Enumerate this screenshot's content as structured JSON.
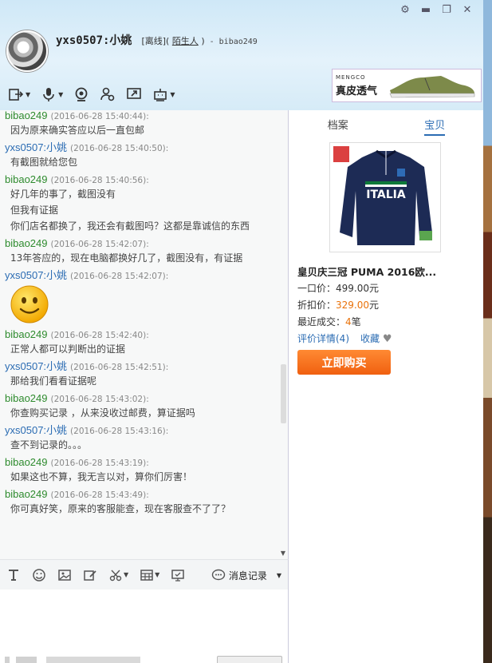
{
  "header": {
    "user_name": "yxs0507:小姚",
    "status_prefix": "[离线](",
    "stranger_label": "陌生人",
    "status_suffix": ")",
    "peer_label": "- bibao249"
  },
  "ad": {
    "brand": "MENGCO",
    "slogan": "真皮透气"
  },
  "messages": [
    {
      "sender": "bibao249",
      "time": "(2016-06-28 15:40:44):",
      "lines": [
        "因为原来确实答应以后一直包邮"
      ],
      "sender_type": "peer"
    },
    {
      "sender": "yxs0507:小姚",
      "time": "(2016-06-28 15:40:50):",
      "lines": [
        "有截图就给您包"
      ],
      "sender_type": "self"
    },
    {
      "sender": "bibao249",
      "time": "(2016-06-28 15:40:56):",
      "lines": [
        "好几年的事了，截图没有",
        "但我有证据",
        "你们店名都换了，我还会有截图吗？这都是靠诚信的东西"
      ],
      "sender_type": "peer"
    },
    {
      "sender": "bibao249",
      "time": "(2016-06-28 15:42:07):",
      "lines": [
        "13年答应的，现在电脑都换好几了，截图没有，有证据"
      ],
      "sender_type": "peer"
    },
    {
      "sender": "yxs0507:小姚",
      "time": "(2016-06-28 15:42:07):",
      "lines": [],
      "emoji": "smiley-face",
      "sender_type": "self"
    },
    {
      "sender": "bibao249",
      "time": "(2016-06-28 15:42:40):",
      "lines": [
        "正常人都可以判断出的证据"
      ],
      "sender_type": "peer"
    },
    {
      "sender": "yxs0507:小姚",
      "time": "(2016-06-28 15:42:51):",
      "lines": [
        "那给我们看看证据呢"
      ],
      "sender_type": "self"
    },
    {
      "sender": "bibao249",
      "time": "(2016-06-28 15:43:02):",
      "lines": [
        "你查购买记录 ，从来没收过邮费，算证据吗"
      ],
      "sender_type": "peer"
    },
    {
      "sender": "yxs0507:小姚",
      "time": "(2016-06-28 15:43:16):",
      "lines": [
        "查不到记录的。。。"
      ],
      "sender_type": "self"
    },
    {
      "sender": "bibao249",
      "time": "(2016-06-28 15:43:19):",
      "lines": [
        "如果这也不算，我无言以对，算你们厉害！"
      ],
      "sender_type": "peer"
    },
    {
      "sender": "bibao249",
      "time": "(2016-06-28 15:43:49):",
      "lines": [
        "你可真好笑，原来的客服能查，现在客服查不了了？"
      ],
      "sender_type": "peer"
    }
  ],
  "input_bar": {
    "history_label": "消息记录"
  },
  "right_panel": {
    "tabs": [
      "档案",
      "宝贝"
    ],
    "active_tab": "宝贝",
    "product_title": "皇贝庆三冠 PUMA 2016欧...",
    "price_label": "一口价：",
    "price_value": "499.00元",
    "discount_label": "折扣价：",
    "discount_value": "329.00",
    "discount_unit": "元",
    "recent_label": "最近成交：",
    "recent_value": "4",
    "recent_unit": "笔",
    "reviews_link": "评价详情(4)",
    "favorite_link": "收藏",
    "buy_button": "立即购买",
    "jersey_text": "ITALIA"
  },
  "colors": {
    "accent_blue": "#2b6cb3",
    "peer_green": "#2e8b2e",
    "orange": "#e9720a"
  }
}
